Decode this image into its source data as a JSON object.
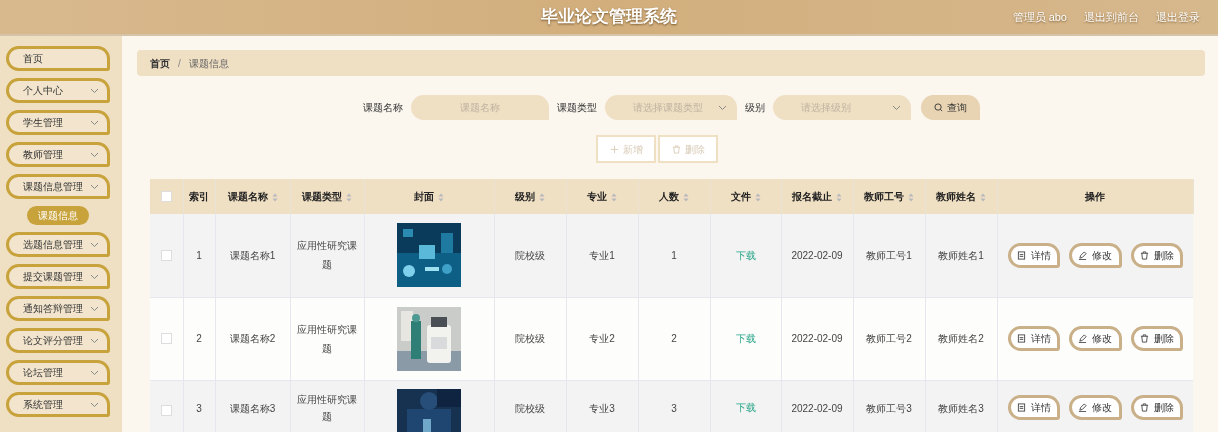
{
  "header": {
    "title": "毕业论文管理系统",
    "user": "管理员 abo",
    "links": [
      "退出到前台",
      "退出登录"
    ]
  },
  "sidebar": {
    "items": [
      {
        "label": "首页",
        "has_arrow": false
      },
      {
        "label": "个人中心",
        "has_arrow": true
      },
      {
        "label": "学生管理",
        "has_arrow": true
      },
      {
        "label": "教师管理",
        "has_arrow": true
      },
      {
        "label": "课题信息管理",
        "has_arrow": true,
        "children": [
          {
            "label": "课题信息",
            "selected": true
          }
        ]
      },
      {
        "label": "选题信息管理",
        "has_arrow": true
      },
      {
        "label": "提交课题管理",
        "has_arrow": true
      },
      {
        "label": "通知答辩管理",
        "has_arrow": true
      },
      {
        "label": "论文评分管理",
        "has_arrow": true
      },
      {
        "label": "论坛管理",
        "has_arrow": true
      },
      {
        "label": "系统管理",
        "has_arrow": true
      }
    ]
  },
  "breadcrumb": {
    "items": [
      "首页",
      "课题信息"
    ],
    "separator": "/"
  },
  "search": {
    "fields": [
      {
        "kind": "input",
        "label": "课题名称",
        "placeholder": "课题名称"
      },
      {
        "kind": "select",
        "label": "课题类型",
        "placeholder": "请选择课题类型"
      },
      {
        "kind": "select",
        "label": "级别",
        "placeholder": "请选择级别"
      }
    ],
    "button": "查询"
  },
  "toolbar": [
    {
      "label": "新增",
      "kind": "add",
      "disabled": true
    },
    {
      "label": "删除",
      "kind": "delete",
      "disabled": true
    }
  ],
  "table": {
    "select_all_checked": false,
    "columns": [
      {
        "label": "索引",
        "sortable": false
      },
      {
        "label": "课题名称",
        "sortable": true
      },
      {
        "label": "课题类型",
        "sortable": true
      },
      {
        "label": "封面",
        "sortable": true
      },
      {
        "label": "级别",
        "sortable": true
      },
      {
        "label": "专业",
        "sortable": true
      },
      {
        "label": "人数",
        "sortable": true
      },
      {
        "label": "文件",
        "sortable": true
      },
      {
        "label": "报名截止",
        "sortable": true
      },
      {
        "label": "教师工号",
        "sortable": true
      },
      {
        "label": "教师姓名",
        "sortable": true
      },
      {
        "label": "操作",
        "sortable": false
      }
    ],
    "rows": [
      {
        "checked": false,
        "index": "1",
        "name": "课题名称1",
        "type": "应用性研究课题",
        "level": "院校级",
        "major": "专业1",
        "count": "1",
        "file": "下载",
        "deadline": "2022-02-09",
        "teacher_id": "教师工号1",
        "teacher_name": "教师姓名1",
        "actions": [
          {
            "label": "详情",
            "kind": "detail"
          },
          {
            "label": "修改",
            "kind": "edit"
          },
          {
            "label": "删除",
            "kind": "delete"
          }
        ]
      },
      {
        "checked": false,
        "index": "2",
        "name": "课题名称2",
        "type": "应用性研究课题",
        "level": "院校级",
        "major": "专业2",
        "count": "2",
        "file": "下载",
        "deadline": "2022-02-09",
        "teacher_id": "教师工号2",
        "teacher_name": "教师姓名2",
        "actions": [
          {
            "label": "详情",
            "kind": "detail"
          },
          {
            "label": "修改",
            "kind": "edit"
          },
          {
            "label": "删除",
            "kind": "delete"
          }
        ]
      },
      {
        "checked": false,
        "index": "3",
        "name": "课题名称3",
        "type": "应用性研究课题",
        "level": "院校级",
        "major": "专业3",
        "count": "3",
        "file": "下载",
        "deadline": "2022-02-09",
        "teacher_id": "教师工号3",
        "teacher_name": "教师姓名3",
        "actions": [
          {
            "label": "详情",
            "kind": "detail"
          },
          {
            "label": "修改",
            "kind": "edit"
          },
          {
            "label": "删除",
            "kind": "delete"
          }
        ]
      }
    ]
  }
}
